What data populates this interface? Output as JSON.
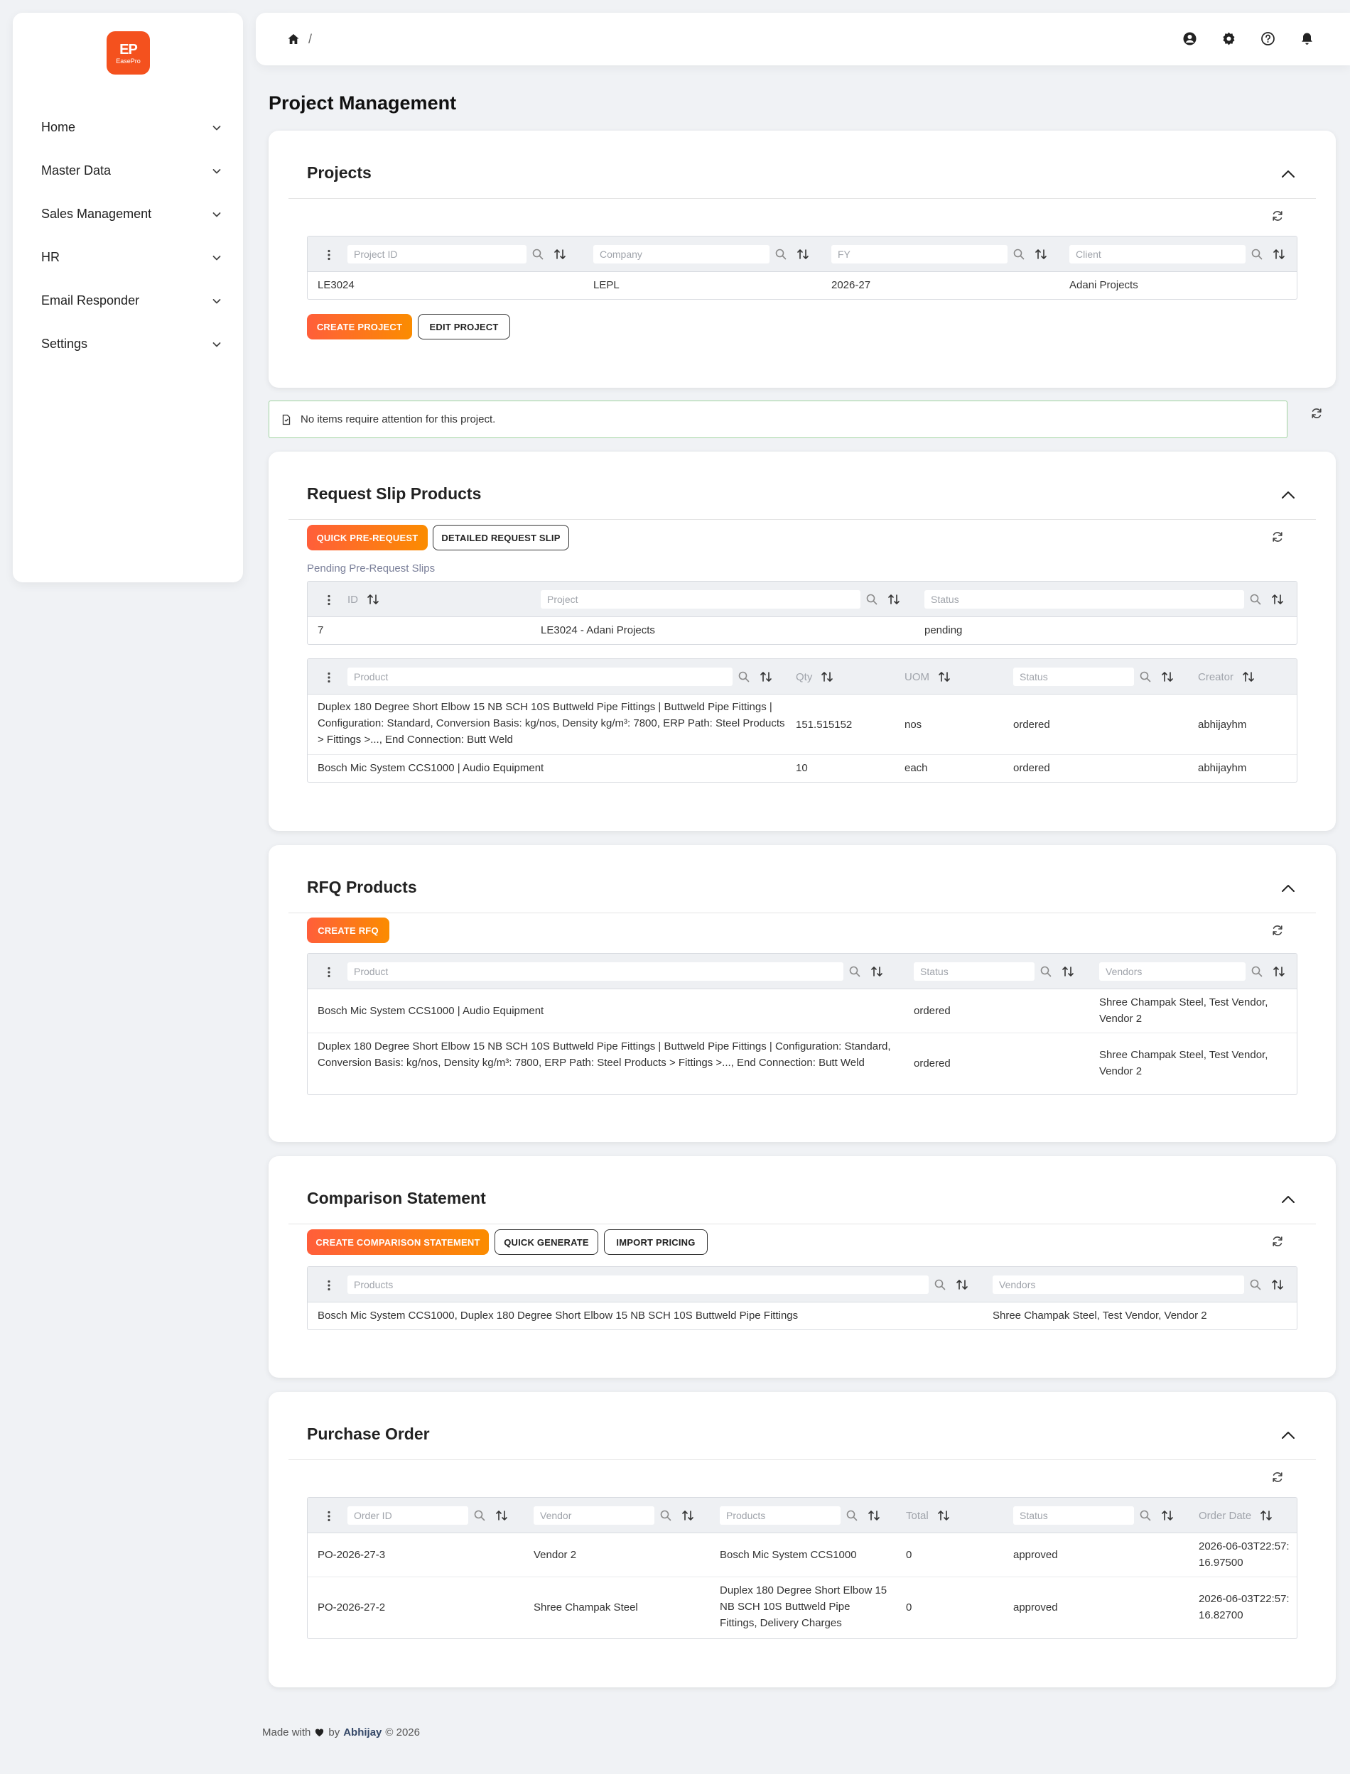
{
  "logo": {
    "mark": "EP",
    "text": "EasePro"
  },
  "sidebar": {
    "items": [
      {
        "label": "Home"
      },
      {
        "label": "Master Data"
      },
      {
        "label": "Sales Management"
      },
      {
        "label": "HR"
      },
      {
        "label": "Email Responder"
      },
      {
        "label": "Settings"
      }
    ]
  },
  "breadcrumb": {
    "separator": "/"
  },
  "page": {
    "title": "Project Management"
  },
  "projects": {
    "title": "Projects",
    "filters": {
      "project_id": "Project ID",
      "company": "Company",
      "fy": "FY",
      "client": "Client"
    },
    "rows": [
      {
        "project_id": "LE3024",
        "company": "LEPL",
        "fy": "2026-27",
        "client": "Adani Projects"
      }
    ],
    "create_label": "Create Project",
    "edit_label": "Edit Project"
  },
  "notice": {
    "text": "No items require attention for this project."
  },
  "request_slip": {
    "title": "Request Slip Products",
    "quick_label": "Quick Pre-Request",
    "detailed_label": "Detailed Request Slip",
    "pending_label": "Pending Pre-Request Slips",
    "pending_headers": {
      "id": "ID",
      "project": "Project",
      "status": "Status"
    },
    "pending_rows": [
      {
        "id": "7",
        "project": "LE3024 - Adani Projects",
        "status": "pending"
      }
    ],
    "product_headers": {
      "product": "Product",
      "qty": "Qty",
      "uom": "UOM",
      "status": "Status",
      "creator": "Creator"
    },
    "product_rows": [
      {
        "product": "Duplex 180 Degree Short Elbow 15 NB SCH 10S Buttweld Pipe Fittings | Buttweld Pipe Fittings | Configuration: Standard, Conversion Basis: kg/nos, Density kg/m³: 7800, ERP Path: Steel Products > Fittings >..., End Connection: Butt Weld",
        "qty": "151.515152",
        "uom": "nos",
        "status": "ordered",
        "creator": "abhijayhm"
      },
      {
        "product": "Bosch Mic System CCS1000 | Audio Equipment",
        "qty": "10",
        "uom": "each",
        "status": "ordered",
        "creator": "abhijayhm"
      }
    ]
  },
  "rfq": {
    "title": "RFQ Products",
    "create_label": "Create RFQ",
    "headers": {
      "product": "Product",
      "status": "Status",
      "vendors": "Vendors"
    },
    "rows": [
      {
        "product": "Bosch Mic System CCS1000 | Audio Equipment",
        "status": "ordered",
        "vendors": "Shree Champak Steel, Test Vendor, Vendor 2"
      },
      {
        "product": "Duplex 180 Degree Short Elbow 15 NB SCH 10S Buttweld Pipe Fittings | Buttweld Pipe Fittings | Configuration: Standard, Conversion Basis: kg/nos, Density kg/m³: 7800, ERP Path: Steel Products > Fittings >..., End Connection: Butt Weld",
        "status": "ordered",
        "vendors": "Shree Champak Steel, Test Vendor, Vendor 2"
      }
    ]
  },
  "comparison": {
    "title": "Comparison Statement",
    "create_label": "Create Comparison Statement",
    "quick_label": "Quick Generate",
    "import_label": "Import Pricing",
    "headers": {
      "products": "Products",
      "vendors": "Vendors"
    },
    "rows": [
      {
        "products": "Bosch Mic System CCS1000, Duplex 180 Degree Short Elbow 15 NB SCH 10S Buttweld Pipe Fittings",
        "vendors": "Shree Champak Steel, Test Vendor, Vendor 2"
      }
    ]
  },
  "purchase_order": {
    "title": "Purchase Order",
    "headers": {
      "order_id": "Order ID",
      "vendor": "Vendor",
      "products": "Products",
      "total": "Total",
      "status": "Status",
      "order_date": "Order Date"
    },
    "rows": [
      {
        "order_id": "PO-2026-27-3",
        "vendor": "Vendor 2",
        "products": "Bosch Mic System CCS1000",
        "total": "0",
        "status": "approved",
        "order_date": "2026-06-03T22:57:16.97500"
      },
      {
        "order_id": "PO-2026-27-2",
        "vendor": "Shree Champak Steel",
        "products": "Duplex 180 Degree Short Elbow 15 NB SCH 10S Buttweld Pipe Fittings, Delivery Charges",
        "total": "0",
        "status": "approved",
        "order_date": "2026-06-03T22:57:16.82700"
      }
    ]
  },
  "footer": {
    "made_with": "Made with",
    "by": "by",
    "author": "Abhijay",
    "copyright": "© 2026"
  },
  "colors": {
    "accent": "#f4511e",
    "primary_gradient_start": "#ff5e3a",
    "primary_gradient_end": "#fb8c00",
    "notice_border": "#9fd29f"
  }
}
